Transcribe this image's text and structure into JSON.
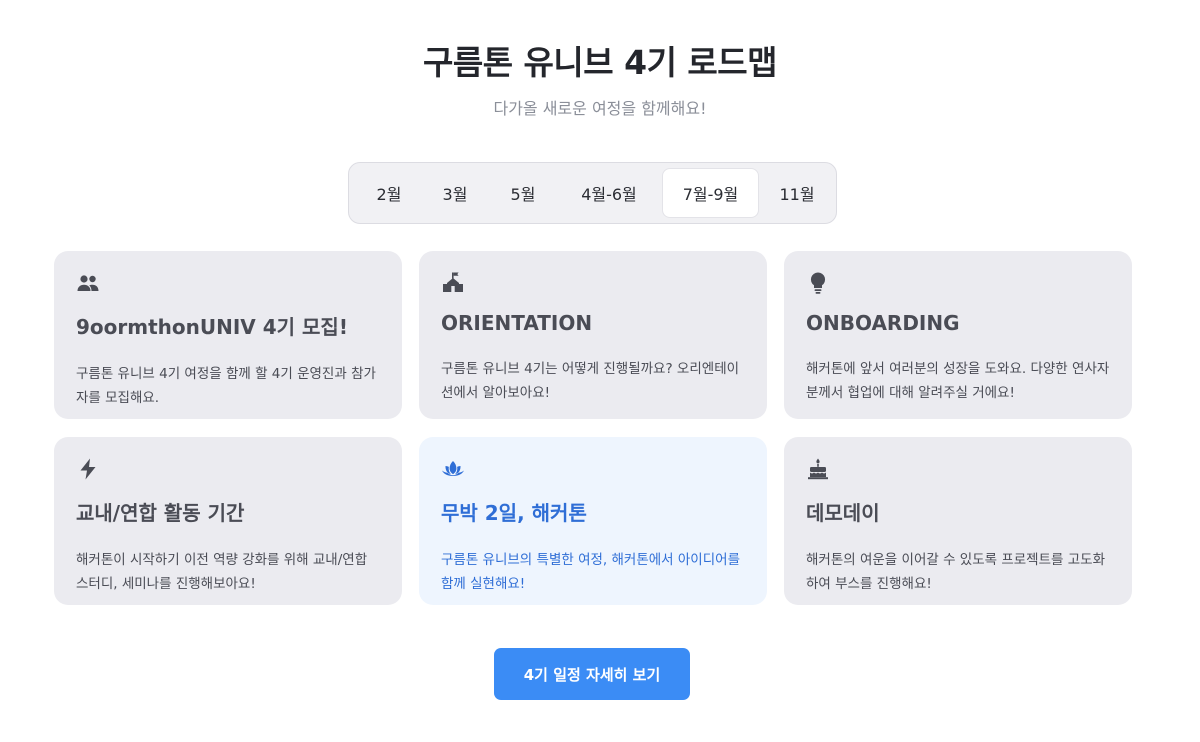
{
  "header": {
    "title": "구름톤 유니브 4기 로드맵",
    "subtitle": "다가올 새로운 여정을 함께해요!"
  },
  "tabs": [
    {
      "label": "2월",
      "active": false
    },
    {
      "label": "3월",
      "active": false
    },
    {
      "label": "5월",
      "active": false
    },
    {
      "label": "4월-6월",
      "active": false
    },
    {
      "label": "7월-9월",
      "active": true
    },
    {
      "label": "11월",
      "active": false
    }
  ],
  "cards": [
    {
      "icon": "people-icon",
      "title": "9oormthonUNIV 4기 모집!",
      "description": "구름톤 유니브 4기 여정을 함께 할 4기 운영진과 참가자를 모집해요.",
      "highlighted": false
    },
    {
      "icon": "school-icon",
      "title": "ORIENTATION",
      "description": "구름톤 유니브 4기는 어떻게 진행될까요? 오리엔테이션에서 알아보아요!",
      "highlighted": false
    },
    {
      "icon": "lightbulb-icon",
      "title": "ONBOARDING",
      "description": "해커톤에 앞서 여러분의 성장을 도와요. 다양한 연사자분께서 협업에 대해 알려주실 거에요!",
      "highlighted": false
    },
    {
      "icon": "lightning-icon",
      "title": "교내/연합 활동 기간",
      "description": "해커톤이 시작하기 이전 역량 강화를 위해 교내/연합 스터디, 세미나를 진행해보아요!",
      "highlighted": false
    },
    {
      "icon": "lotus-icon",
      "title": "무박 2일, 해커톤",
      "description": "구름톤 유니브의 특별한 여정, 해커톤에서 아이디어를 함께 실현해요!",
      "highlighted": true
    },
    {
      "icon": "cake-icon",
      "title": "데모데이",
      "description": "해커톤의 여운을 이어갈 수 있도록 프로젝트를 고도화하여 부스를 진행해요!",
      "highlighted": false
    }
  ],
  "cta": {
    "label": "4기 일정 자세히 보기"
  },
  "colors": {
    "accent": "#3b8cf5",
    "highlight_text": "#2f6ed6",
    "card_bg": "#ebebf0",
    "highlight_bg": "#eef5fe"
  }
}
